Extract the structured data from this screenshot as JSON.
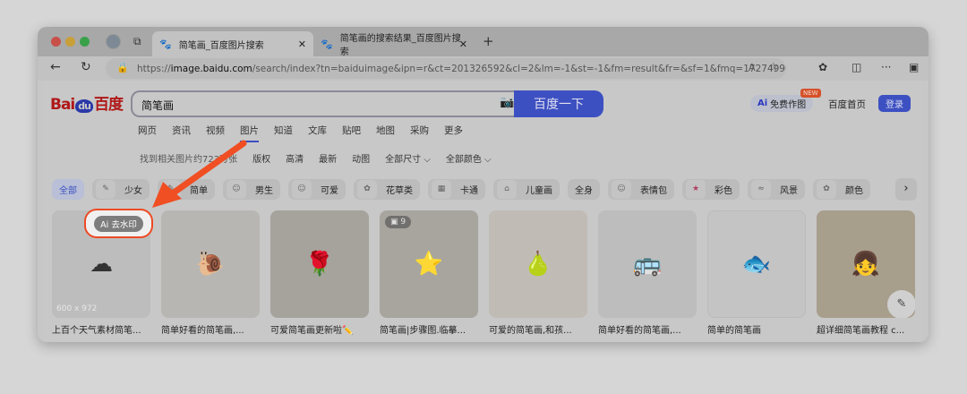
{
  "browser": {
    "tabs": [
      {
        "title": "简笔画_百度图片搜索",
        "active": true
      },
      {
        "title": "简笔画的搜索结果_百度图片搜索",
        "active": false
      }
    ],
    "url_prefix": "https://",
    "url_host": "image.baidu.com",
    "url_rest": "/search/index?tn=baiduimage&ipn=r&ct=201326592&cl=2&lm=-1&st=-1&fm=result&fr=&sf=1&fmq=17274996..."
  },
  "header": {
    "logo": "Bai du 百度",
    "query": "简笔画",
    "search_button": "百度一下",
    "ai_button": "免费作图",
    "ai_prefix": "Ai",
    "new_badge": "NEW",
    "home_link": "百度首页",
    "login_button": "登录"
  },
  "nav": [
    "网页",
    "资讯",
    "视频",
    "图片",
    "知道",
    "文库",
    "贴吧",
    "地图",
    "采购",
    "更多"
  ],
  "filters": {
    "count": "找到相关图片约723万张",
    "items": [
      "版权",
      "高清",
      "最新",
      "动图",
      "全部尺寸 ⌵",
      "全部颜色 ⌵"
    ]
  },
  "chips": [
    "全部",
    "少女",
    "简单",
    "男生",
    "可爱",
    "花草类",
    "卡通",
    "儿童画",
    "全身",
    "表情包",
    "彩色",
    "风景",
    "颜色"
  ],
  "results": [
    {
      "caption": "上百个天气素材简笔...",
      "dims": "600 x 972",
      "glyph": "☁"
    },
    {
      "caption": "简单好看的简笔画,...",
      "glyph": "🐌"
    },
    {
      "caption": "可爱简笔画更新啦✏️",
      "glyph": "🌹"
    },
    {
      "caption": "简笔画|步骤图.临摹...",
      "badge": "9",
      "glyph": "⭐"
    },
    {
      "caption": "可爱的简笔画,和孩...",
      "glyph": "🍐"
    },
    {
      "caption": "简单好看的简笔画,...",
      "glyph": "🚌"
    },
    {
      "caption": "简单的简笔画",
      "glyph": "🐟"
    },
    {
      "caption": "超详细简笔画教程 c...",
      "glyph": "👧"
    }
  ],
  "watermark_button": "Ai 去水印",
  "colors": {
    "accent": "#3d50c2",
    "annotation": "#ee4a24"
  }
}
